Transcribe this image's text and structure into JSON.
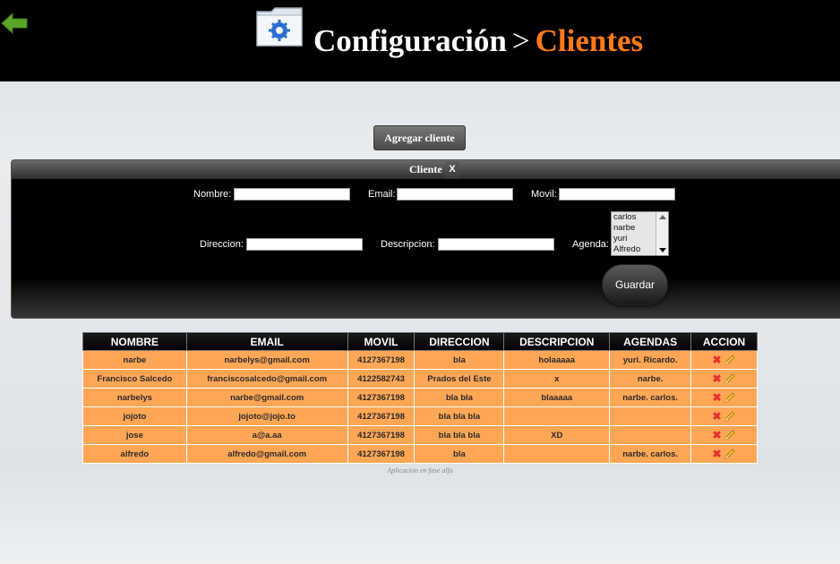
{
  "header": {
    "title": "Configuración",
    "separator": ">",
    "current": "Clientes",
    "colors": {
      "background": "#000000",
      "current": "#ff7a1a",
      "back_arrow": "#5aa52a"
    }
  },
  "add_button": {
    "label": "Agregar cliente"
  },
  "form": {
    "title": "Cliente",
    "close_label": "X",
    "fields": {
      "nombre": {
        "label": "Nombre:",
        "value": ""
      },
      "email": {
        "label": "Email:",
        "value": ""
      },
      "movil": {
        "label": "Movil:",
        "value": ""
      },
      "direccion": {
        "label": "Direccion:",
        "value": ""
      },
      "descripcion": {
        "label": "Descripcion:",
        "value": ""
      },
      "agenda": {
        "label": "Agenda:",
        "options": [
          "carlos",
          "narbe",
          "yuri",
          "Alfredo"
        ]
      }
    },
    "save_label": "Guardar"
  },
  "table": {
    "headers": [
      "NOMBRE",
      "EMAIL",
      "MOVIL",
      "DIRECCION",
      "DESCRIPCION",
      "AGENDAS",
      "ACCION"
    ],
    "rows": [
      [
        "narbe",
        "narbelys@gmail.com",
        "4127367198",
        "bla",
        "holaaaaa",
        "yuri. Ricardo."
      ],
      [
        "Francisco Salcedo",
        "franciscosalcedo@gmail.com",
        "4122582743",
        "Prados del Este",
        "x",
        "narbe."
      ],
      [
        "narbelys",
        "narbe@gmail.com",
        "4127367198",
        "bla bla",
        "blaaaaa",
        "narbe. carlos."
      ],
      [
        "jojoto",
        "jojoto@jojo.to",
        "4127367198",
        "bla bla bla",
        "",
        ""
      ],
      [
        "jose",
        "a@a.aa",
        "4127367198",
        "bla bla bla",
        "XD",
        ""
      ],
      [
        "alfredo",
        "alfredo@gmail.com",
        "4127367198",
        "bla",
        "",
        "narbe. carlos."
      ]
    ],
    "row_color": "#ffa655",
    "action_icons": [
      "delete-icon",
      "edit-icon"
    ]
  },
  "footer": "Aplicacion en fase alfa"
}
